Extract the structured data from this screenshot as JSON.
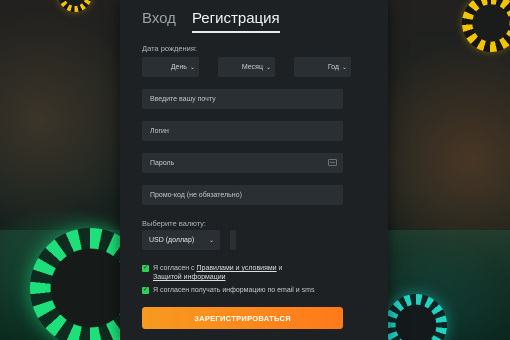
{
  "tabs": {
    "login": "Вход",
    "register": "Регистрация"
  },
  "dob": {
    "label": "Дата рождения:",
    "day": "День",
    "month": "Месяц",
    "year": "Год"
  },
  "fields": {
    "email_placeholder": "Введите вашу почту",
    "login_placeholder": "Логин",
    "password_placeholder": "Пароль",
    "promo_placeholder": "Промо-код (не обязательно)"
  },
  "currency": {
    "label": "Выберите валюту:",
    "value": "USD (доллар)"
  },
  "agree": {
    "prefix": "Я согласен с",
    "terms_link": "Правилами и условиями",
    "middle": "и",
    "privacy_link": "Защитой информации"
  },
  "marketing": {
    "label": "Я согласен получать информацию по email и sms"
  },
  "submit_label": "ЗАРЕГИСТРИРОВАТЬСЯ",
  "icons": {
    "dropdown": "chevron-down-icon",
    "eye": "eye-icon",
    "check": "checkmark-icon"
  },
  "colors": {
    "accent": "#f7931e",
    "checkbox": "#2ecc58",
    "panel": "#1d2124"
  }
}
